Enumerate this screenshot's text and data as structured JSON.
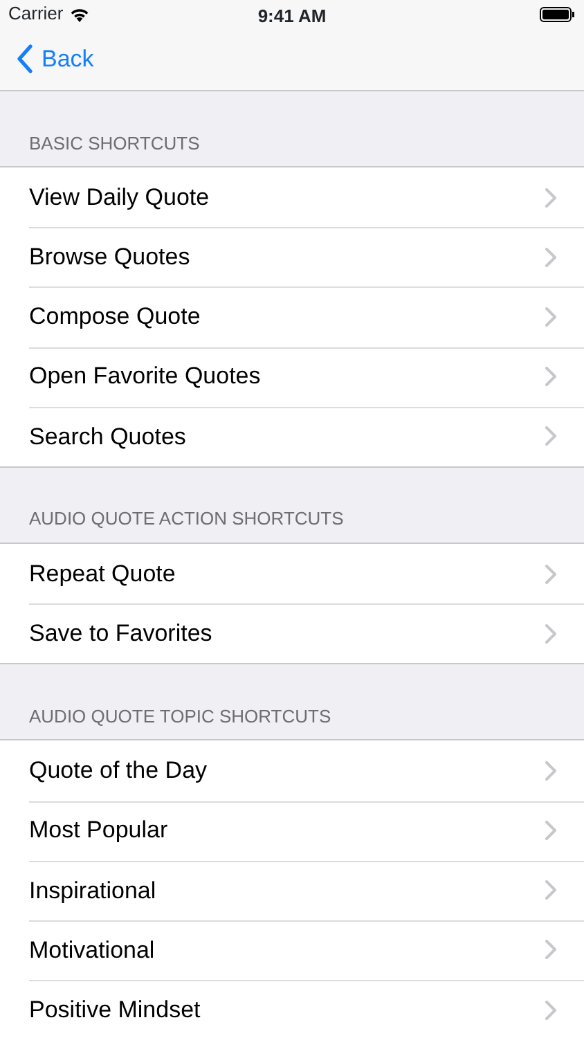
{
  "status_bar": {
    "carrier": "Carrier",
    "time": "9:41 AM"
  },
  "nav_bar": {
    "back_label": "Back"
  },
  "sections": [
    {
      "header": "BASIC SHORTCUTS",
      "items": [
        "View Daily Quote",
        "Browse Quotes",
        "Compose Quote",
        "Open Favorite Quotes",
        "Search Quotes"
      ]
    },
    {
      "header": "AUDIO QUOTE ACTION SHORTCUTS",
      "items": [
        "Repeat Quote",
        "Save to Favorites"
      ]
    },
    {
      "header": "AUDIO QUOTE TOPIC SHORTCUTS",
      "items": [
        "Quote of the Day",
        "Most Popular",
        "Inspirational",
        "Motivational",
        "Positive Mindset"
      ]
    }
  ]
}
